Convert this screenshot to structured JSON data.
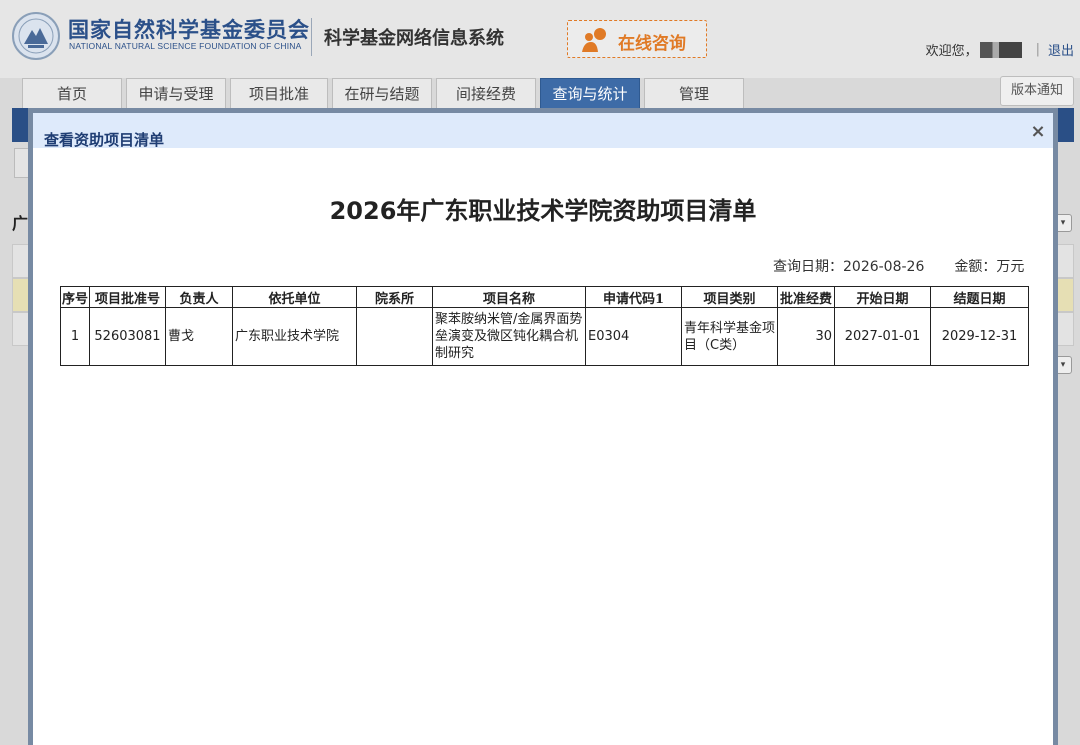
{
  "header": {
    "org_name_cn": "国家自然科学基金委员会",
    "org_name_en": "NATIONAL NATURAL SCIENCE FOUNDATION OF CHINA",
    "system_name": "科学基金网络信息系统",
    "consult_label": "在线咨询",
    "welcome": "欢迎您，",
    "logout": "退出",
    "version_notice": "版本通知"
  },
  "nav": {
    "tabs": [
      {
        "label": "首页"
      },
      {
        "label": "申请与受理"
      },
      {
        "label": "项目批准"
      },
      {
        "label": "在研与结题"
      },
      {
        "label": "间接经费"
      },
      {
        "label": "查询与统计",
        "active": true
      },
      {
        "label": "管理"
      }
    ]
  },
  "background": {
    "fragment_text": "广"
  },
  "modal": {
    "title": "查看资助项目清单",
    "document_title": "2026年广东职业技术学院资助项目清单",
    "query_date_label": "查询日期：",
    "query_date": "2026-08-26",
    "amount_unit_label": "金额：万元",
    "table": {
      "headers": [
        "序号",
        "项目批准号",
        "负责人",
        "依托单位",
        "院系所",
        "项目名称",
        "申请代码1",
        "项目类别",
        "批准经费",
        "开始日期",
        "结题日期"
      ],
      "rows": [
        {
          "index": "1",
          "approval_no": "52603081",
          "leader": "曹戈",
          "institution": "广东职业技术学院",
          "department": "",
          "project_name": "聚苯胺纳米管/金属界面势垒演变及微区钝化耦合机制研究",
          "code": "E0304",
          "category": "青年科学基金项目（C类）",
          "funding": "30",
          "start_date": "2027-01-01",
          "end_date": "2029-12-31"
        }
      ]
    }
  },
  "colors": {
    "brand_blue": "#2b5089",
    "accent_orange": "#e07a26",
    "active_tab": "#3d6ba7",
    "modal_header_bg": "#deeafb"
  }
}
